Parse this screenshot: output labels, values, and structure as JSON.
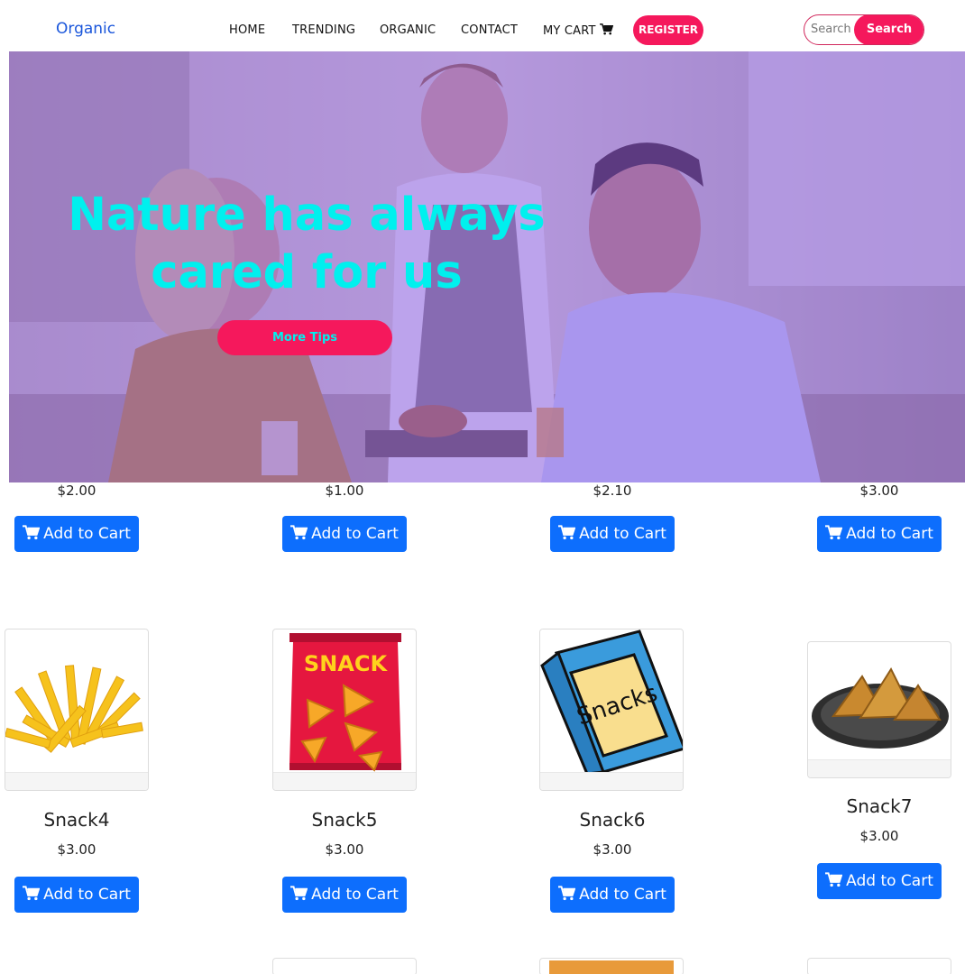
{
  "navbar": {
    "brand": "Organic",
    "links": [
      "HOME",
      "TRENDING",
      "ORGANIC",
      "CONTACT",
      "MY CART"
    ],
    "register_label": "REGISTER",
    "search_placeholder": "Search",
    "search_button": "Search"
  },
  "hero": {
    "title_line1": "Nature has always",
    "title_line2": "cared for us",
    "button_label": "More Tips"
  },
  "top_row": {
    "prices": [
      "$2.00",
      "$1.00",
      "$2.10",
      "$3.00"
    ],
    "button_label": "Add to Cart"
  },
  "products": [
    {
      "name": "Snack4",
      "price": "$3.00",
      "button_label": "Add to Cart",
      "image": "french-fries"
    },
    {
      "name": "Snack5",
      "price": "$3.00",
      "button_label": "Add to Cart",
      "image": "snack-bag-red"
    },
    {
      "name": "Snack6",
      "price": "$3.00",
      "button_label": "Add to Cart",
      "image": "snacks-bag-blue"
    },
    {
      "name": "Snack7",
      "price": "$3.00",
      "button_label": "Add to Cart",
      "image": "samosa-plate"
    }
  ],
  "image_text": {
    "snack5_bag": "SNACK",
    "snack6_bag": "Snacks"
  },
  "colors": {
    "brand": "#1a56db",
    "accent_pink": "#f5185c",
    "hero_text": "#00f0ee",
    "hero_overlay": "#804eeb",
    "primary_button": "#0d6efd"
  }
}
